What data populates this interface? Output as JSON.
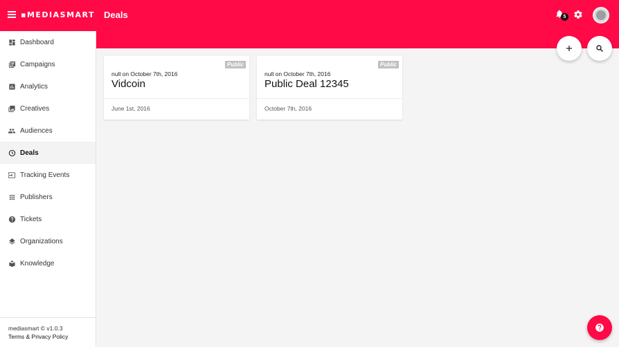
{
  "app": {
    "logo_text": "▪MEDIASMART",
    "page_title": "Deals",
    "brand_color": "#ff0a47"
  },
  "header": {
    "notification_count": "5",
    "icons": [
      "menu-icon",
      "bell-icon",
      "gear-icon",
      "avatar"
    ]
  },
  "sidebar": {
    "items": [
      {
        "label": "Dashboard",
        "icon": "dashboard-icon"
      },
      {
        "label": "Campaigns",
        "icon": "campaigns-icon"
      },
      {
        "label": "Analytics",
        "icon": "analytics-icon"
      },
      {
        "label": "Creatives",
        "icon": "creatives-icon"
      },
      {
        "label": "Audiences",
        "icon": "audiences-icon"
      },
      {
        "label": "Deals",
        "icon": "clock-icon",
        "active": true
      },
      {
        "label": "Tracking Events",
        "icon": "tracking-icon"
      },
      {
        "label": "Publishers",
        "icon": "grid-icon"
      },
      {
        "label": "Tickets",
        "icon": "help-circle-icon"
      },
      {
        "label": "Organizations",
        "icon": "layers-icon"
      },
      {
        "label": "Knowledge",
        "icon": "knowledge-icon"
      }
    ],
    "footer": {
      "version": "mediasmart © v1.0.3",
      "links": "Terms & Privacy Policy"
    }
  },
  "actions": {
    "add": "add-icon",
    "search": "search-icon",
    "help": "help-icon"
  },
  "deals": [
    {
      "badge": "Public",
      "meta": "null on October 7th, 2016",
      "title": "Vidcoin",
      "date": "June 1st, 2016"
    },
    {
      "badge": "Public",
      "meta": "null on October 7th, 2016",
      "title": "Public Deal 12345",
      "date": "October 7th, 2016"
    }
  ]
}
